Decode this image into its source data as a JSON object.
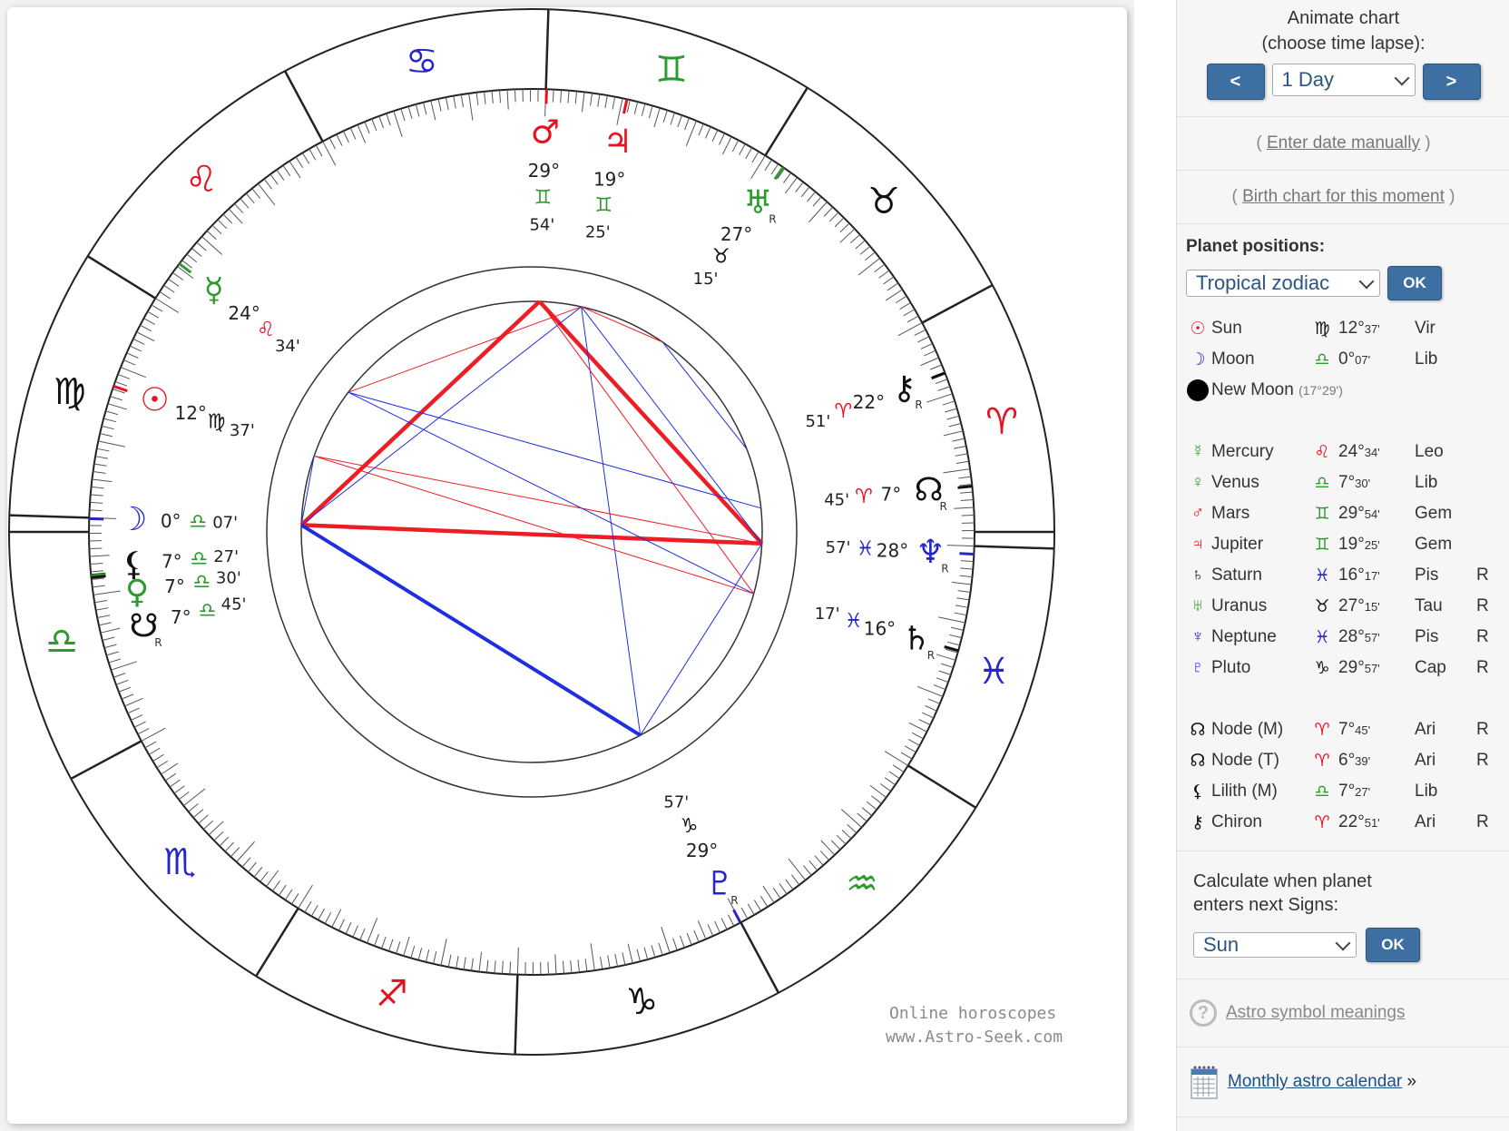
{
  "colors": {
    "fire": "#e8101f",
    "earth": "#111111",
    "air": "#2e9a2e",
    "water": "#2626c8",
    "button": "#3e6fa3",
    "link": "#1a4f8a"
  },
  "chart": {
    "watermark": [
      "Online horoscopes",
      "www.Astro-Seek.com"
    ],
    "zodiac_glyphs": [
      "♈",
      "♉",
      "♊",
      "♋",
      "♌",
      "♍",
      "♎",
      "♏",
      "♐",
      "♑",
      "♒",
      "♓"
    ],
    "planets": [
      {
        "name": "Pluto",
        "glyph": "♇",
        "deg": "29°",
        "sign": "♑",
        "min": "57'",
        "retro": "R"
      },
      {
        "name": "Saturn",
        "glyph": "♄",
        "deg": "16°",
        "sign": "♓",
        "min": "17'",
        "retro": "R"
      },
      {
        "name": "Neptune",
        "glyph": "♆",
        "deg": "28°",
        "sign": "♓",
        "min": "57'",
        "retro": "R"
      },
      {
        "name": "Node",
        "glyph": "☊",
        "deg": "7°",
        "sign": "♈",
        "min": "45'",
        "retro": "R"
      },
      {
        "name": "Chiron",
        "glyph": "⚷",
        "deg": "22°",
        "sign": "♈",
        "min": "51'",
        "retro": "R"
      },
      {
        "name": "Uranus",
        "glyph": "♅",
        "deg": "27°",
        "sign": "♉",
        "min": "15'",
        "retro": "R"
      },
      {
        "name": "Jupiter",
        "glyph": "♃",
        "deg": "19°",
        "sign": "♊",
        "min": "25'",
        "retro": ""
      },
      {
        "name": "Mars",
        "glyph": "♂",
        "deg": "29°",
        "sign": "♊",
        "min": "54'",
        "retro": ""
      },
      {
        "name": "Mercury",
        "glyph": "☿",
        "deg": "24°",
        "sign": "♌",
        "min": "34'",
        "retro": ""
      },
      {
        "name": "Sun",
        "glyph": "☉",
        "deg": "12°",
        "sign": "♍",
        "min": "37'",
        "retro": ""
      },
      {
        "name": "Moon",
        "glyph": "☽",
        "deg": "0°",
        "sign": "♎",
        "min": "07'",
        "retro": ""
      },
      {
        "name": "Lilith",
        "glyph": "⚸",
        "deg": "7°",
        "sign": "♎",
        "min": "27'",
        "retro": ""
      },
      {
        "name": "Venus",
        "glyph": "♀",
        "deg": "7°",
        "sign": "♎",
        "min": "30'",
        "retro": ""
      },
      {
        "name": "South Node",
        "glyph": "☋",
        "deg": "7°",
        "sign": "♎",
        "min": "45'",
        "retro": "R"
      }
    ]
  },
  "sidebar": {
    "animate": {
      "title_line1": "Animate chart",
      "title_line2": "(choose time lapse):",
      "prev": "<",
      "next": ">",
      "lapse": "1 Day"
    },
    "enter_date": {
      "open": "( ",
      "link": "Enter date manually",
      "close": " )"
    },
    "birth_chart": {
      "open": "( ",
      "link": "Birth chart for this moment",
      "close": " )"
    },
    "planet_positions": {
      "title": "Planet positions:",
      "zodiac": "Tropical zodiac",
      "ok": "OK",
      "rows": [
        {
          "glyph": "☉",
          "color": "#e8101f",
          "name": "Sun",
          "sign": "♍",
          "signcolor": "#111111",
          "deg": "12°",
          "min": "37'",
          "abbr": "Vir",
          "retro": ""
        },
        {
          "glyph": "☽",
          "color": "#2626c8",
          "name": "Moon",
          "sign": "♎",
          "signcolor": "#2e9a2e",
          "deg": "0°",
          "min": "07'",
          "abbr": "Lib",
          "retro": ""
        }
      ],
      "new_moon": {
        "name": "New Moon",
        "detail": "(17°29')"
      },
      "rows2": [
        {
          "glyph": "☿",
          "color": "#2e9a2e",
          "name": "Mercury",
          "sign": "♌",
          "signcolor": "#e8101f",
          "deg": "24°",
          "min": "34'",
          "abbr": "Leo",
          "retro": ""
        },
        {
          "glyph": "♀",
          "color": "#2e9a2e",
          "name": "Venus",
          "sign": "♎",
          "signcolor": "#2e9a2e",
          "deg": "7°",
          "min": "30'",
          "abbr": "Lib",
          "retro": ""
        },
        {
          "glyph": "♂",
          "color": "#e8101f",
          "name": "Mars",
          "sign": "♊",
          "signcolor": "#2e9a2e",
          "deg": "29°",
          "min": "54'",
          "abbr": "Gem",
          "retro": ""
        },
        {
          "glyph": "♃",
          "color": "#e8101f",
          "name": "Jupiter",
          "sign": "♊",
          "signcolor": "#2e9a2e",
          "deg": "19°",
          "min": "25'",
          "abbr": "Gem",
          "retro": ""
        },
        {
          "glyph": "♄",
          "color": "#111111",
          "name": "Saturn",
          "sign": "♓",
          "signcolor": "#2626c8",
          "deg": "16°",
          "min": "17'",
          "abbr": "Pis",
          "retro": "R"
        },
        {
          "glyph": "♅",
          "color": "#2e9a2e",
          "name": "Uranus",
          "sign": "♉",
          "signcolor": "#111111",
          "deg": "27°",
          "min": "15'",
          "abbr": "Tau",
          "retro": "R"
        },
        {
          "glyph": "♆",
          "color": "#2626c8",
          "name": "Neptune",
          "sign": "♓",
          "signcolor": "#2626c8",
          "deg": "28°",
          "min": "57'",
          "abbr": "Pis",
          "retro": "R"
        },
        {
          "glyph": "♇",
          "color": "#2626c8",
          "name": "Pluto",
          "sign": "♑",
          "signcolor": "#111111",
          "deg": "29°",
          "min": "57'",
          "abbr": "Cap",
          "retro": "R"
        }
      ],
      "rows3": [
        {
          "glyph": "☊",
          "color": "#111111",
          "name": "Node (M)",
          "sign": "♈",
          "signcolor": "#e8101f",
          "deg": "7°",
          "min": "45'",
          "abbr": "Ari",
          "retro": "R"
        },
        {
          "glyph": "☊",
          "color": "#111111",
          "name": "Node (T)",
          "sign": "♈",
          "signcolor": "#e8101f",
          "deg": "6°",
          "min": "39'",
          "abbr": "Ari",
          "retro": "R"
        },
        {
          "glyph": "⚸",
          "color": "#111111",
          "name": "Lilith (M)",
          "sign": "♎",
          "signcolor": "#2e9a2e",
          "deg": "7°",
          "min": "27'",
          "abbr": "Lib",
          "retro": ""
        },
        {
          "glyph": "⚷",
          "color": "#111111",
          "name": "Chiron",
          "sign": "♈",
          "signcolor": "#e8101f",
          "deg": "22°",
          "min": "51'",
          "abbr": "Ari",
          "retro": "R"
        }
      ]
    },
    "calc": {
      "title_line1": "Calculate when planet",
      "title_line2": "enters next Signs:",
      "planet": "Sun",
      "ok": "OK"
    },
    "help": {
      "icon": "question-icon",
      "link": "Astro symbol meanings"
    },
    "calendar": {
      "icon": "calendar-icon",
      "link": "Monthly astro calendar",
      "suffix": " »"
    }
  }
}
